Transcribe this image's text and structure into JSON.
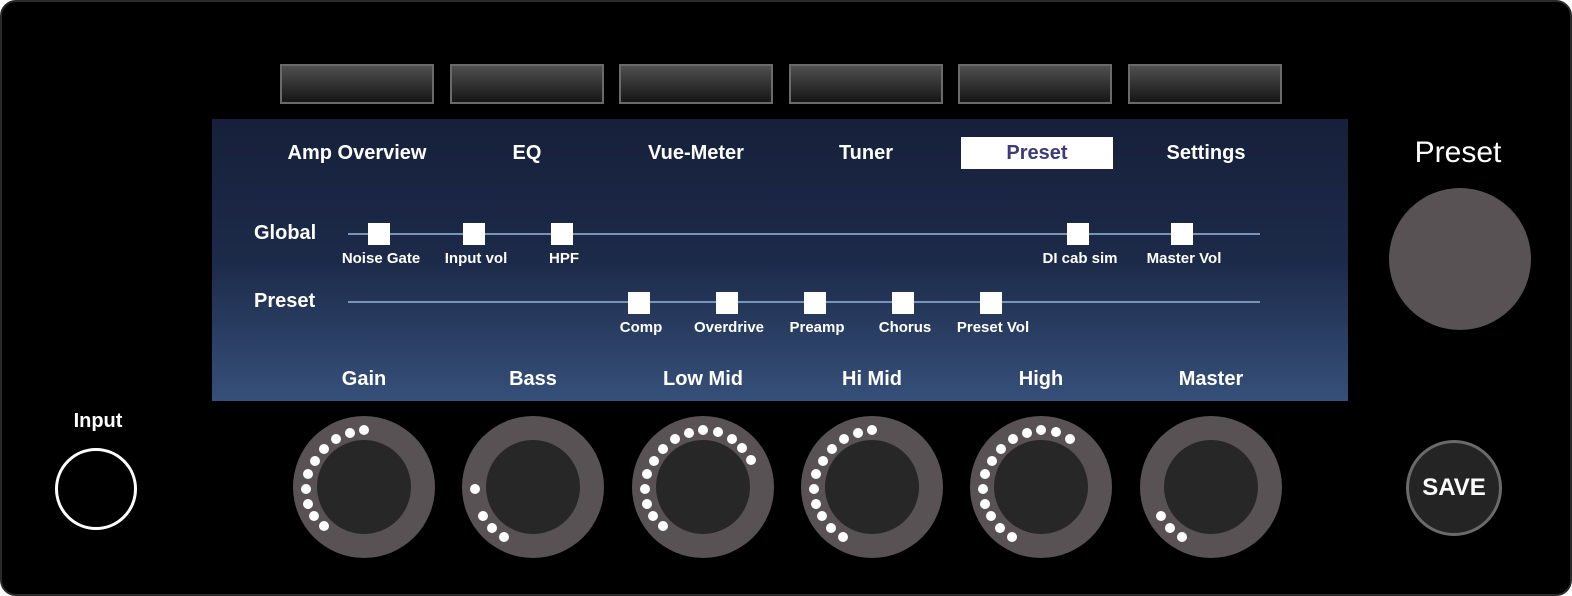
{
  "screen": {
    "tabs": [
      {
        "label": "Amp Overview",
        "active": false
      },
      {
        "label": "EQ",
        "active": false
      },
      {
        "label": "Vue-Meter",
        "active": false
      },
      {
        "label": "Tuner",
        "active": false
      },
      {
        "label": "Preset",
        "active": true
      },
      {
        "label": "Settings",
        "active": false
      }
    ],
    "global": {
      "label": "Global",
      "nodes": [
        "Noise Gate",
        "Input vol",
        "HPF",
        "DI cab sim",
        "Master Vol"
      ]
    },
    "preset": {
      "label": "Preset",
      "nodes": [
        "Comp",
        "Overdrive",
        "Preamp",
        "Chorus",
        "Preset Vol"
      ]
    }
  },
  "knobs": [
    {
      "label": "Gain"
    },
    {
      "label": "Bass"
    },
    {
      "label": "Low Mid"
    },
    {
      "label": "Hi Mid"
    },
    {
      "label": "High"
    },
    {
      "label": "Master"
    }
  ],
  "input": {
    "label": "Input"
  },
  "preset_encoder": {
    "label": "Preset"
  },
  "save_button": {
    "label": "SAVE"
  },
  "colors": {
    "active_tab_text": "#3c3a78",
    "screen_top": "#16203a",
    "screen_bottom": "#36507a",
    "knob_ring": "#585254"
  }
}
